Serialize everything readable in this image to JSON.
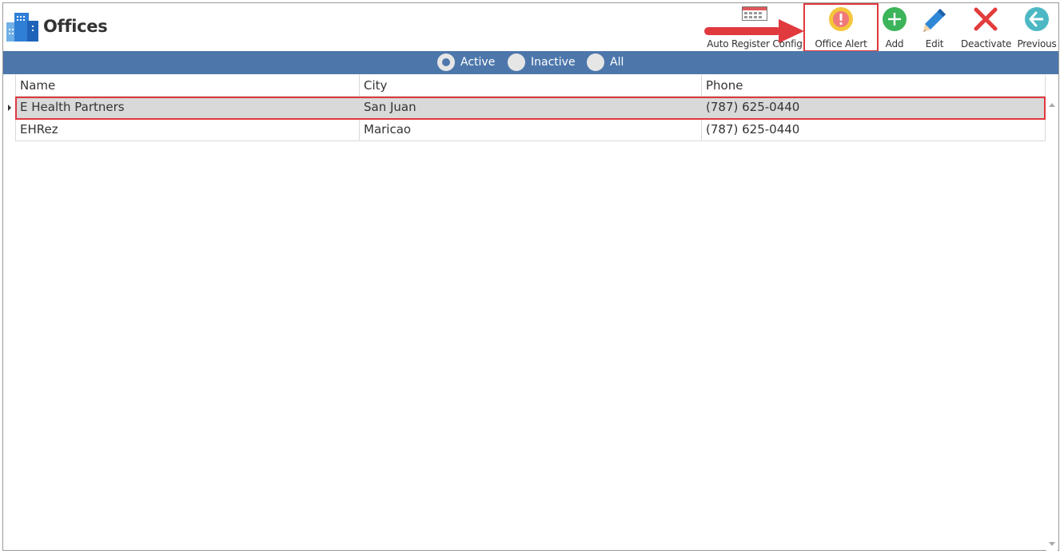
{
  "header": {
    "title": "Offices"
  },
  "toolbar": {
    "auto_register_label": "Auto Register Config",
    "office_alert_label": "Office Alert",
    "add_label": "Add",
    "edit_label": "Edit",
    "deactivate_label": "Deactivate",
    "previous_label": "Previous"
  },
  "filters": {
    "active_label": "Active",
    "inactive_label": "Inactive",
    "all_label": "All",
    "selected": "Active"
  },
  "table": {
    "columns": [
      "Name",
      "City",
      "Phone"
    ],
    "rows": [
      {
        "name": "E Health Partners",
        "city": "San Juan",
        "phone": "(787) 625-0440"
      },
      {
        "name": "EHRez",
        "city": "Maricao",
        "phone": "(787) 625-0440"
      }
    ]
  },
  "colors": {
    "accent": "#4d77ab",
    "highlight": "#e0393e"
  }
}
